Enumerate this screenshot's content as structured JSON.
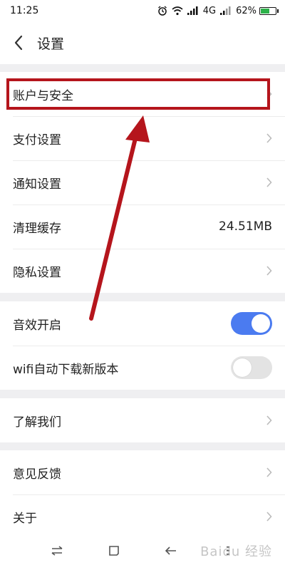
{
  "status_bar": {
    "time": "11:25",
    "network": "4G",
    "battery_percent": "62%",
    "battery_level": 0.62,
    "battery_color": "#2db24a"
  },
  "header": {
    "title": "设置",
    "back_icon": "chevron-left-icon"
  },
  "groups": [
    {
      "items": [
        {
          "label": "账户与安全",
          "type": "chevron"
        },
        {
          "label": "支付设置",
          "type": "chevron"
        },
        {
          "label": "通知设置",
          "type": "chevron"
        },
        {
          "label": "清理缓存",
          "type": "value",
          "value": "24.51MB"
        },
        {
          "label": "隐私设置",
          "type": "chevron"
        }
      ]
    },
    {
      "items": [
        {
          "label": "音效开启",
          "type": "toggle",
          "on": true
        },
        {
          "label": "wifi自动下载新版本",
          "type": "toggle",
          "on": false
        }
      ]
    },
    {
      "items": [
        {
          "label": "了解我们",
          "type": "chevron"
        }
      ]
    },
    {
      "items": [
        {
          "label": "意见反馈",
          "type": "chevron"
        },
        {
          "label": "关于",
          "type": "chevron"
        }
      ]
    }
  ],
  "annotation": {
    "highlight_color": "#b5151c",
    "highlighted_item": "账户与安全"
  },
  "colors": {
    "toggle_on": "#4b7bf0",
    "toggle_off": "#e3e3e3",
    "background": "#efeff1"
  },
  "watermark": "Baidu 经验"
}
